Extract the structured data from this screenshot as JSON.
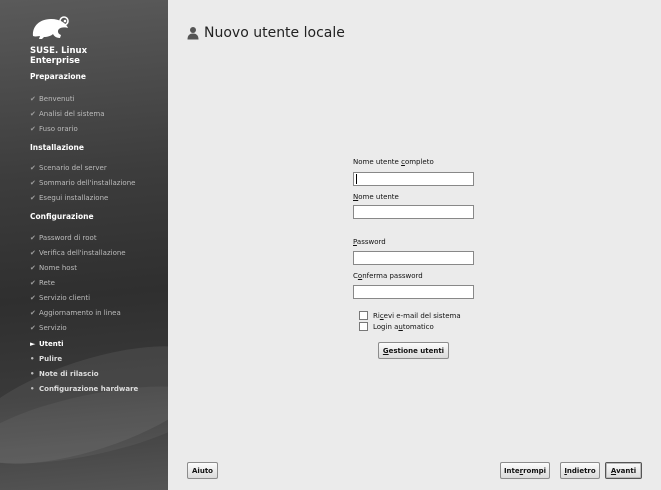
{
  "brand": {
    "line1": "SUSE. Linux",
    "line2": "Enterprise"
  },
  "sidebar": {
    "sections": [
      {
        "label": "Preparazione",
        "steps": [
          {
            "label": "Benvenuti",
            "state": "done"
          },
          {
            "label": "Analisi del sistema",
            "state": "done"
          },
          {
            "label": "Fuso orario",
            "state": "done"
          }
        ]
      },
      {
        "label": "Installazione",
        "steps": [
          {
            "label": "Scenario del server",
            "state": "done"
          },
          {
            "label": "Sommario dell'installazione",
            "state": "done"
          },
          {
            "label": "Esegui installazione",
            "state": "done"
          }
        ]
      },
      {
        "label": "Configurazione",
        "steps": [
          {
            "label": "Password di root",
            "state": "done"
          },
          {
            "label": "Verifica dell'installazione",
            "state": "done"
          },
          {
            "label": "Nome host",
            "state": "done"
          },
          {
            "label": "Rete",
            "state": "done"
          },
          {
            "label": "Servizio clienti",
            "state": "done"
          },
          {
            "label": "Aggiornamento in linea",
            "state": "done"
          },
          {
            "label": "Servizio",
            "state": "done"
          },
          {
            "label": "Utenti",
            "state": "current"
          },
          {
            "label": "Pulire",
            "state": "pending"
          },
          {
            "label": "Note di rilascio",
            "state": "pending"
          },
          {
            "label": "Configurazione hardware",
            "state": "pending"
          }
        ]
      }
    ]
  },
  "page": {
    "title": "Nuovo utente locale"
  },
  "form": {
    "full_name_label": "Nome utente completo",
    "full_name_value": "",
    "username_label": "Nome utente",
    "username_value": "",
    "password_label": "Password",
    "password_value": "",
    "confirm_label": "Conferma password",
    "confirm_value": "",
    "receive_mail_label": "Ricevi e-mail del sistema",
    "receive_mail_checked": false,
    "autologin_label": "Login automatico",
    "autologin_checked": false,
    "manage_users_label": "Gestione utenti"
  },
  "footer": {
    "help_label": "Aiuto",
    "abort_label": "Interrompi",
    "back_label": "Indietro",
    "next_label": "Avanti"
  }
}
